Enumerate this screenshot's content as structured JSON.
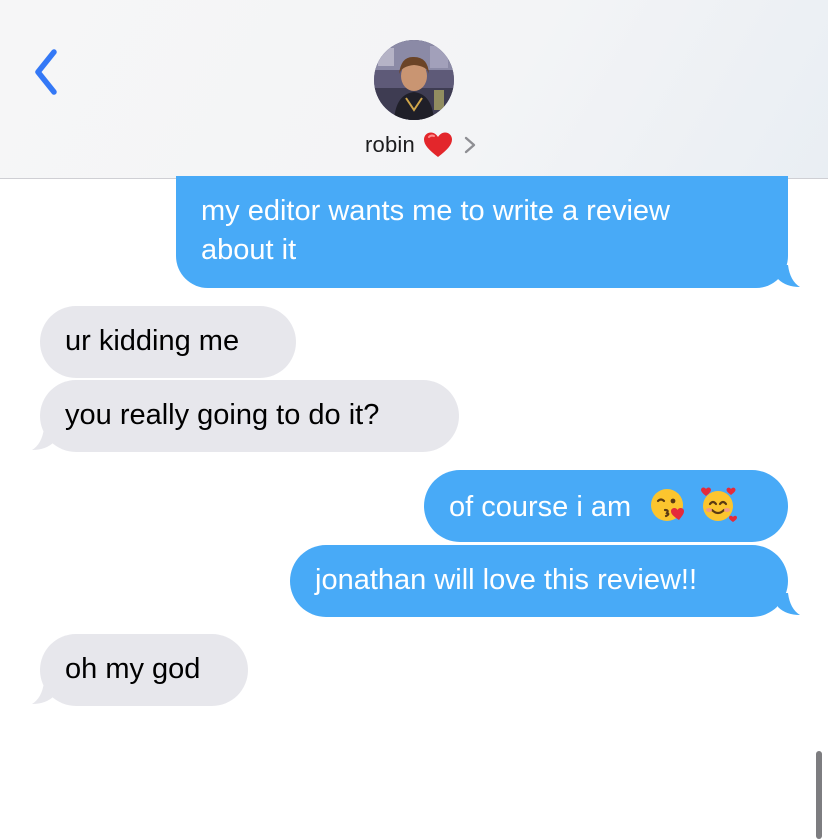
{
  "header": {
    "contact_name": "robin",
    "back_icon": "chevron-left-icon",
    "avatar_icon": "avatar",
    "heart_icon": "red-heart-emoji",
    "details_icon": "chevron-right-icon",
    "accent_color": "#3478f6"
  },
  "messages": [
    {
      "direction": "outgoing",
      "lines": [
        "my editor wants me to write a review",
        "about it"
      ],
      "tail": true
    },
    {
      "direction": "incoming",
      "text": "ur kidding me",
      "tail": false
    },
    {
      "direction": "incoming",
      "text": "you really going to do it?",
      "tail": true
    },
    {
      "direction": "outgoing",
      "text": "of course i am",
      "emojis": [
        "kissing-face-with-heart-emoji",
        "smiling-face-with-hearts-emoji"
      ],
      "tail": false
    },
    {
      "direction": "outgoing",
      "text": "jonathan will love this review!!",
      "tail": true
    },
    {
      "direction": "incoming",
      "text": "oh my god",
      "tail": true
    }
  ],
  "colors": {
    "outgoing_bubble": "#48aaf7",
    "incoming_bubble": "#e7e7ec"
  }
}
